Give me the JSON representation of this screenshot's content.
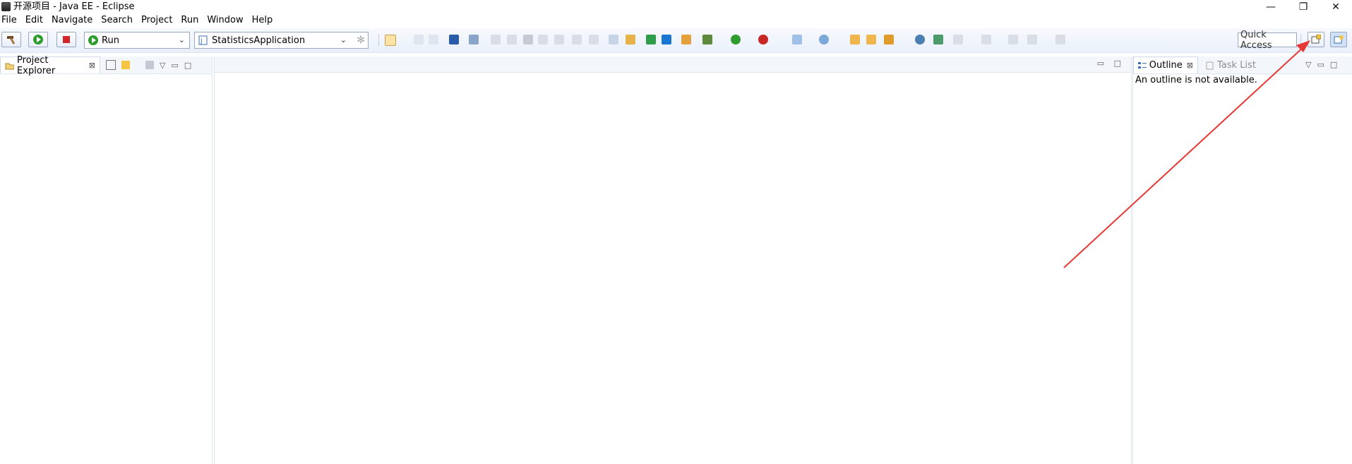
{
  "window": {
    "title": "开源项目 - Java EE - Eclipse",
    "controls": {
      "minimize": "—",
      "restore": "❐",
      "close": "✕"
    }
  },
  "menubar": {
    "items": [
      "File",
      "Edit",
      "Navigate",
      "Search",
      "Project",
      "Run",
      "Window",
      "Help"
    ]
  },
  "toolbar": {
    "launch_mode": "Run",
    "launch_config": "StatisticsApplication",
    "quick_access_label": "Quick Access"
  },
  "left_panel": {
    "tab_label": "Project Explorer"
  },
  "right_panel": {
    "tabs": [
      {
        "label": "Outline",
        "active": true
      },
      {
        "label": "Task List",
        "active": false
      }
    ],
    "message": "An outline is not available."
  },
  "annotation": {
    "color": "#e53935",
    "target": "open-perspective-button"
  }
}
